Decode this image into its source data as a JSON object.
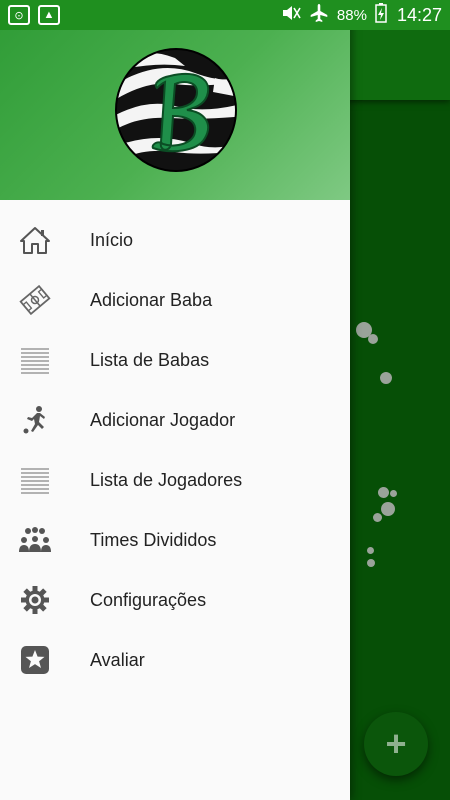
{
  "status_bar": {
    "battery": "88%",
    "time": "14:27"
  },
  "drawer": {
    "items": [
      {
        "label": "Início",
        "icon": "home-icon"
      },
      {
        "label": "Adicionar Baba",
        "icon": "field-icon"
      },
      {
        "label": "Lista de Babas",
        "icon": "list-icon"
      },
      {
        "label": "Adicionar Jogador",
        "icon": "player-kick-icon"
      },
      {
        "label": "Lista de Jogadores",
        "icon": "list-icon"
      },
      {
        "label": "Times Divididos",
        "icon": "group-icon"
      },
      {
        "label": "Configurações",
        "icon": "gear-icon"
      },
      {
        "label": "Avaliar",
        "icon": "star-icon"
      }
    ]
  },
  "fab": {
    "symbol": "+"
  },
  "colors": {
    "header_start": "#2e9b35",
    "header_end": "#7fc983",
    "status_bar": "#1f8f1f",
    "background_app": "#064f06"
  }
}
